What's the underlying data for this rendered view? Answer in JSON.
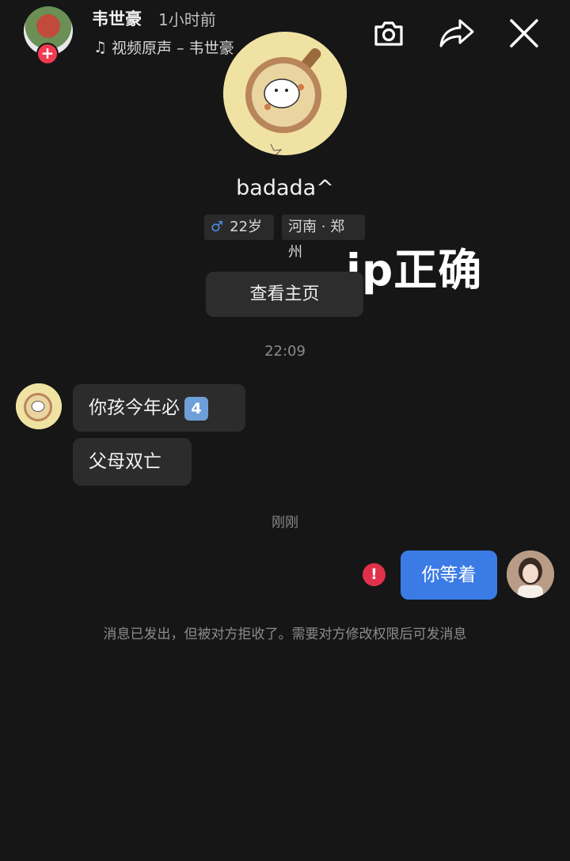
{
  "header": {
    "name": "韦世豪",
    "time": "1小时前",
    "music": "视频原声 – 韦世豪"
  },
  "profile": {
    "name": "badada^",
    "age": "22岁",
    "location": "河南 · 郑州",
    "view_button": "查看主页"
  },
  "overlay_caption": "ip正确",
  "timestamps": [
    "22:09",
    "刚刚"
  ],
  "messages": [
    {
      "from": "them",
      "text": "你孩今年必",
      "keycap": "4"
    },
    {
      "from": "them",
      "text": "父母双亡"
    },
    {
      "from": "me",
      "text": "你等着",
      "status": "rejected"
    }
  ],
  "notice": "消息已发出，但被对方拒收了。需要对方修改权限后可发消息",
  "colors": {
    "accent": "#3b7be6",
    "error": "#e0314b",
    "follow": "#f23a51",
    "background": "#161616"
  }
}
